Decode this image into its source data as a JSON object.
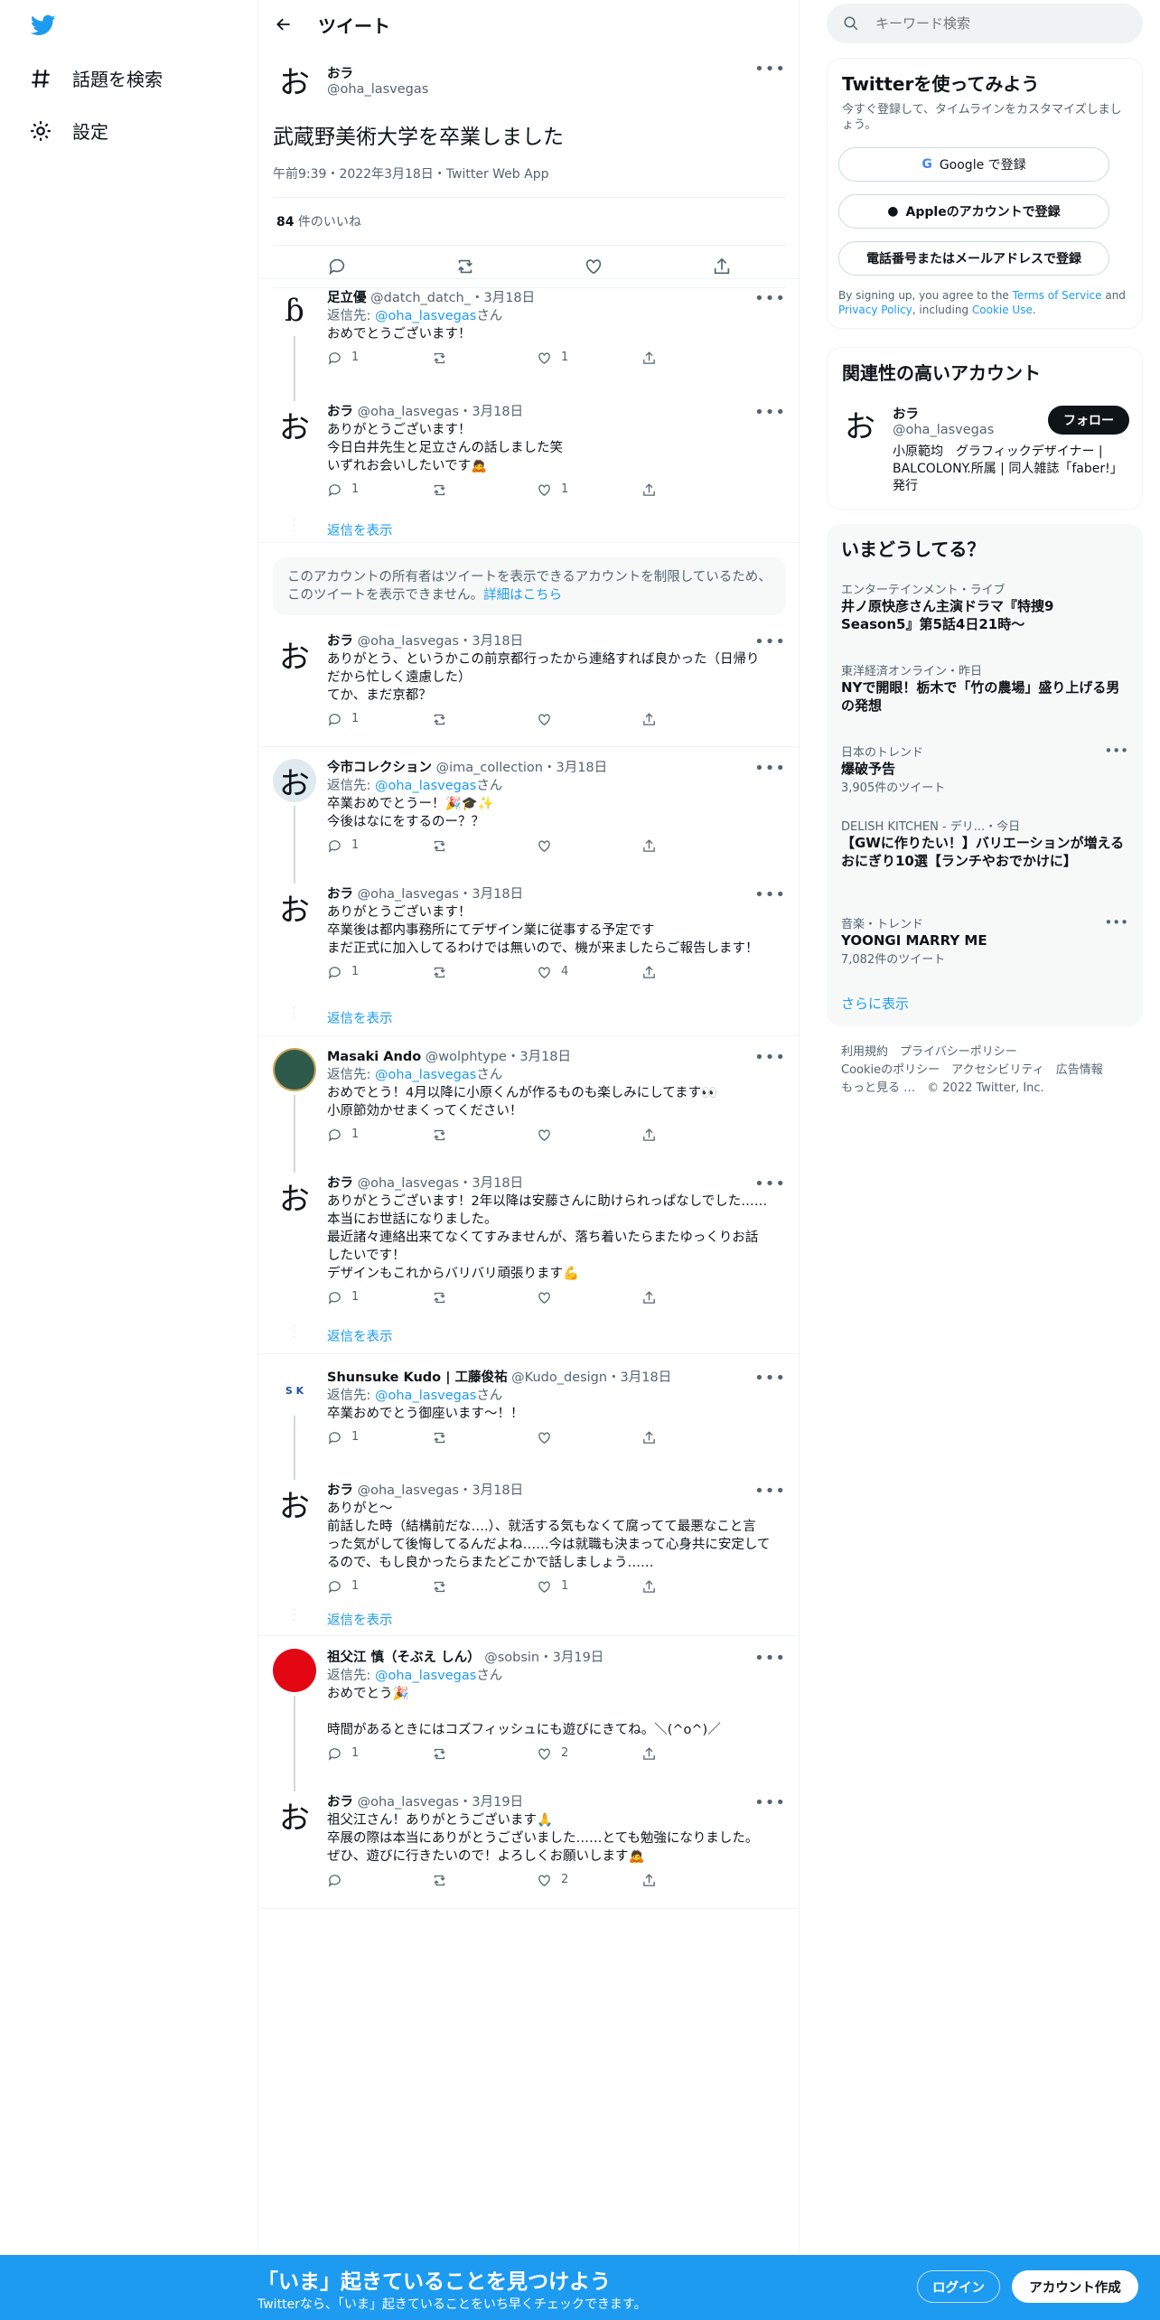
{
  "nav": {
    "explore": "話題を検索",
    "settings": "設定"
  },
  "header": {
    "title": "ツイート"
  },
  "focal": {
    "avatar_char": "お",
    "name": "おラ",
    "handle": "@oha_lasvegas",
    "text": "武蔵野美術大学を卒業しました",
    "meta": "午前9:39・2022年3月18日・Twitter Web App",
    "likes_count": "84",
    "likes_label": " 件のいいね"
  },
  "replies": [
    {
      "avatar": "ɓ",
      "name": "足立優",
      "handle": "@datch_datch_",
      "date": "・3月18日",
      "reply_to_prefix": "返信先: ",
      "reply_to": "@oha_lasvegas",
      "reply_to_suffix": "さん",
      "lines": [
        "おめでとうございます！"
      ],
      "reply": "1",
      "retweet": "",
      "like": "1"
    },
    {
      "avatar": "お",
      "name": "おラ",
      "handle": "@oha_lasvegas",
      "date": "・3月18日",
      "lines": [
        "ありがとうございます！",
        "今日白井先生と足立さんの話しました笑",
        "いずれお会いしたいです🙇"
      ],
      "reply": "1",
      "retweet": "",
      "like": "1"
    },
    {
      "avatar": "お",
      "name": "おラ",
      "handle": "@oha_lasvegas",
      "date": "・3月18日",
      "lines": [
        "ありがとう、というかこの前京都行ったから連絡すれば良かった（日帰り",
        "だから忙しく遠慮した）",
        "てか、まだ京都？"
      ],
      "reply": "1",
      "retweet": "",
      "like": ""
    },
    {
      "avatar": "お",
      "name": "今市コレクション",
      "handle": "@ima_collection",
      "date": "・3月18日",
      "reply_to_prefix": "返信先: ",
      "reply_to": "@oha_lasvegas",
      "reply_to_suffix": "さん",
      "lines": [
        "卒業おめでとうー！🎉🎓✨",
        "今後はなにをするのー？？"
      ],
      "reply": "1",
      "retweet": "",
      "like": ""
    },
    {
      "avatar": "お",
      "name": "おラ",
      "handle": "@oha_lasvegas",
      "date": "・3月18日",
      "lines": [
        "ありがとうございます！",
        "卒業後は都内事務所にてデザイン業に従事する予定です",
        "まだ正式に加入してるわけでは無いので、機が来ましたらご報告します！"
      ],
      "reply": "1",
      "retweet": "",
      "like": "4"
    },
    {
      "avatar": "",
      "name": "Masaki Ando",
      "handle": "@wolphtype",
      "date": "・3月18日",
      "reply_to_prefix": "返信先: ",
      "reply_to": "@oha_lasvegas",
      "reply_to_suffix": "さん",
      "lines": [
        "おめでとう！4月以降に小原くんが作るものも楽しみにしてます👀",
        "小原節効かせまくってください！"
      ],
      "reply": "1",
      "retweet": "",
      "like": ""
    },
    {
      "avatar": "お",
      "name": "おラ",
      "handle": "@oha_lasvegas",
      "date": "・3月18日",
      "lines": [
        "ありがとうございます！2年以降は安藤さんに助けられっぱなしでした……",
        "本当にお世話になりました。",
        "最近諸々連絡出来てなくてすみませんが、落ち着いたらまたゆっくりお話",
        "したいです！",
        "デザインもこれからバリバリ頑張ります💪"
      ],
      "reply": "1",
      "retweet": "",
      "like": ""
    },
    {
      "avatar": "S K",
      "name": "Shunsuke Kudo | 工藤俊祐",
      "handle": "@Kudo_design",
      "date": "・3月18日",
      "reply_to_prefix": "返信先: ",
      "reply_to": "@oha_lasvegas",
      "reply_to_suffix": "さん",
      "lines": [
        "卒業おめでとう御座います〜！！"
      ],
      "reply": "1",
      "retweet": "",
      "like": ""
    },
    {
      "avatar": "お",
      "name": "おラ",
      "handle": "@oha_lasvegas",
      "date": "・3月18日",
      "lines": [
        "ありがと〜",
        "前話した時（結構前だな….）、就活する気もなくて腐ってて最悪なこと言",
        "った気がして後悔してるんだよね……今は就職も決まって心身共に安定して",
        "るので、もし良かったらまたどこかで話しましょう……"
      ],
      "reply": "1",
      "retweet": "",
      "like": "1"
    },
    {
      "avatar": "",
      "name": "祖父江 慎（そぶえ しん）",
      "handle": "@sobsin",
      "date": "・3月19日",
      "reply_to_prefix": "返信先: ",
      "reply_to": "@oha_lasvegas",
      "reply_to_suffix": "さん",
      "lines": [
        "おめでとう🎉",
        "",
        "時間があるときにはコズフィッシュにも遊びにきてね。＼(^o^)／"
      ],
      "reply": "1",
      "retweet": "",
      "like": "2"
    },
    {
      "avatar": "お",
      "name": "おラ",
      "handle": "@oha_lasvegas",
      "date": "・3月19日",
      "lines": [
        "祖父江さん！ありがとうございます🙏",
        "卒展の際は本当にありがとうございました……とても勉強になりました。",
        "ぜひ、遊びに行きたいので！よろしくお願いします🙇"
      ],
      "reply": "",
      "retweet": "",
      "like": "2"
    }
  ],
  "show_replies": "返信を表示",
  "notice": {
    "text": "このアカウントの所有者はツイートを表示できるアカウントを制限しているた",
    "text2": "め、このツイートを表示できません。",
    "link": "詳細はこちら"
  },
  "search": {
    "placeholder": "キーワード検索"
  },
  "signup_card": {
    "title": "Twitterを使ってみよう",
    "subtitle": "今すぐ登録して、タイムラインをカスタマイズしましょう。",
    "google": "Google で登録",
    "apple": "Appleのアカウントで登録",
    "phone": "電話番号またはメールアドレスで登録",
    "terms_prefix": "By signing up, you agree to the ",
    "terms": "Terms of Service",
    "and": " and ",
    "privacy": "Privacy Policy",
    "including": ", including ",
    "cookie": "Cookie Use",
    "period": "."
  },
  "related": {
    "title": "関連性の高いアカウント",
    "name": "おラ",
    "handle": "@oha_lasvegas",
    "follow": "フォロー",
    "bio": "小原範均　グラフィックデザイナー | BALCOLONY.所属 | 同人雑誌「faber!」発行"
  },
  "trends": {
    "title": "いまどうしてる？",
    "items": [
      {
        "cat": "エンターテインメント・ライブ",
        "name": "井ノ原快彦さん主演ドラマ『特捜9 Season5』第5話4日21時〜",
        "count": ""
      },
      {
        "cat": "東洋経済オンライン・昨日",
        "name": "NYで開眼！栃木で「竹の農場」盛り上げる男の発想",
        "count": ""
      },
      {
        "cat": "日本のトレンド",
        "name": "爆破予告",
        "count": "3,905件のツイート"
      },
      {
        "cat": "DELISH KITCHEN - デリ...・今日",
        "name": "【GWに作りたい！】バリエーションが増えるおにぎり10選【ランチやおでかけに】",
        "count": ""
      },
      {
        "cat": "音楽・トレンド",
        "name": "YOONGI MARRY ME",
        "count": "7,082件のツイート"
      }
    ],
    "show_more": "さらに表示"
  },
  "footer": {
    "terms": "利用規約",
    "privacy": "プライバシーポリシー",
    "cookie": "Cookieのポリシー",
    "access": "アクセシビリティ",
    "ads": "広告情報",
    "more": "もっと見る …",
    "copyright": "© 2022 Twitter, Inc."
  },
  "bottom": {
    "title": "「いま」起きていることを見つけよう",
    "subtitle": "Twitterなら、「いま」起きていることをいち早くチェックできます。",
    "login": "ログイン",
    "signup": "アカウント作成"
  },
  "colors": {
    "accent": "#1d9bf0",
    "text": "#0f1419",
    "muted": "#536471"
  }
}
